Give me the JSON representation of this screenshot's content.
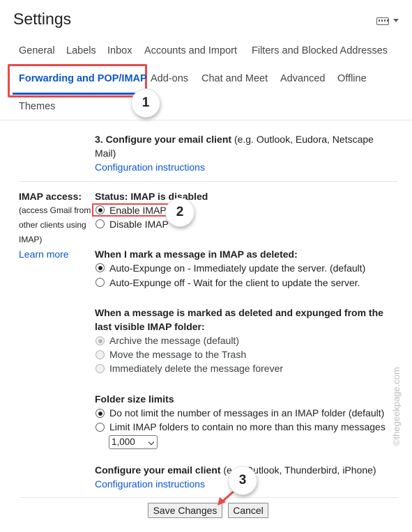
{
  "header": {
    "title": "Settings",
    "input_tools_icon": "keyboard-icon"
  },
  "tabs": [
    {
      "label": "General"
    },
    {
      "label": "Labels"
    },
    {
      "label": "Inbox"
    },
    {
      "label": "Accounts and Import"
    },
    {
      "label": "Filters and Blocked Addresses"
    },
    {
      "label": "Forwarding and POP/IMAP",
      "active": true
    },
    {
      "label": "Add-ons"
    },
    {
      "label": "Chat and Meet"
    },
    {
      "label": "Advanced"
    },
    {
      "label": "Offline"
    },
    {
      "label": "Themes"
    }
  ],
  "pop_section": {
    "step_title": "3. Configure your email client",
    "step_hint": "(e.g. Outlook, Eudora, Netscape",
    "step_hint_2": "Mail)",
    "config_link": "Configuration instructions"
  },
  "imap": {
    "label": "IMAP access:",
    "desc_lines": [
      "(access Gmail from",
      "other clients using",
      "IMAP)"
    ],
    "learn_more": "Learn more",
    "status": "Status: IMAP is disabled",
    "enable": "Enable IMAP",
    "disable": "Disable IMAP",
    "deleted_heading": "When I mark a message in IMAP as deleted:",
    "deleted_options": [
      "Auto-Expunge on - Immediately update the server. (default)",
      "Auto-Expunge off - Wait for the client to update the server."
    ],
    "expunged_heading_1": "When a message is marked as deleted and expunged from the",
    "expunged_heading_2": "last visible IMAP folder:",
    "expunged_options": [
      "Archive the message (default)",
      "Move the message to the Trash",
      "Immediately delete the message forever"
    ],
    "folder_heading": "Folder size limits",
    "folder_options": [
      "Do not limit the number of messages in an IMAP folder (default)",
      "Limit IMAP folders to contain no more than this many messages"
    ],
    "folder_limit_value": "1,000",
    "client_title": "Configure your email client",
    "client_hint": "(e.g. Outlook, Thunderbird, iPhone)",
    "client_link": "Configuration instructions"
  },
  "buttons": {
    "save": "Save Changes",
    "cancel": "Cancel"
  },
  "callouts": [
    "1",
    "2",
    "3"
  ],
  "watermark": "©thegeekpage.com",
  "colors": {
    "accent": "#0b57d0",
    "highlight": "#e84a4a"
  }
}
